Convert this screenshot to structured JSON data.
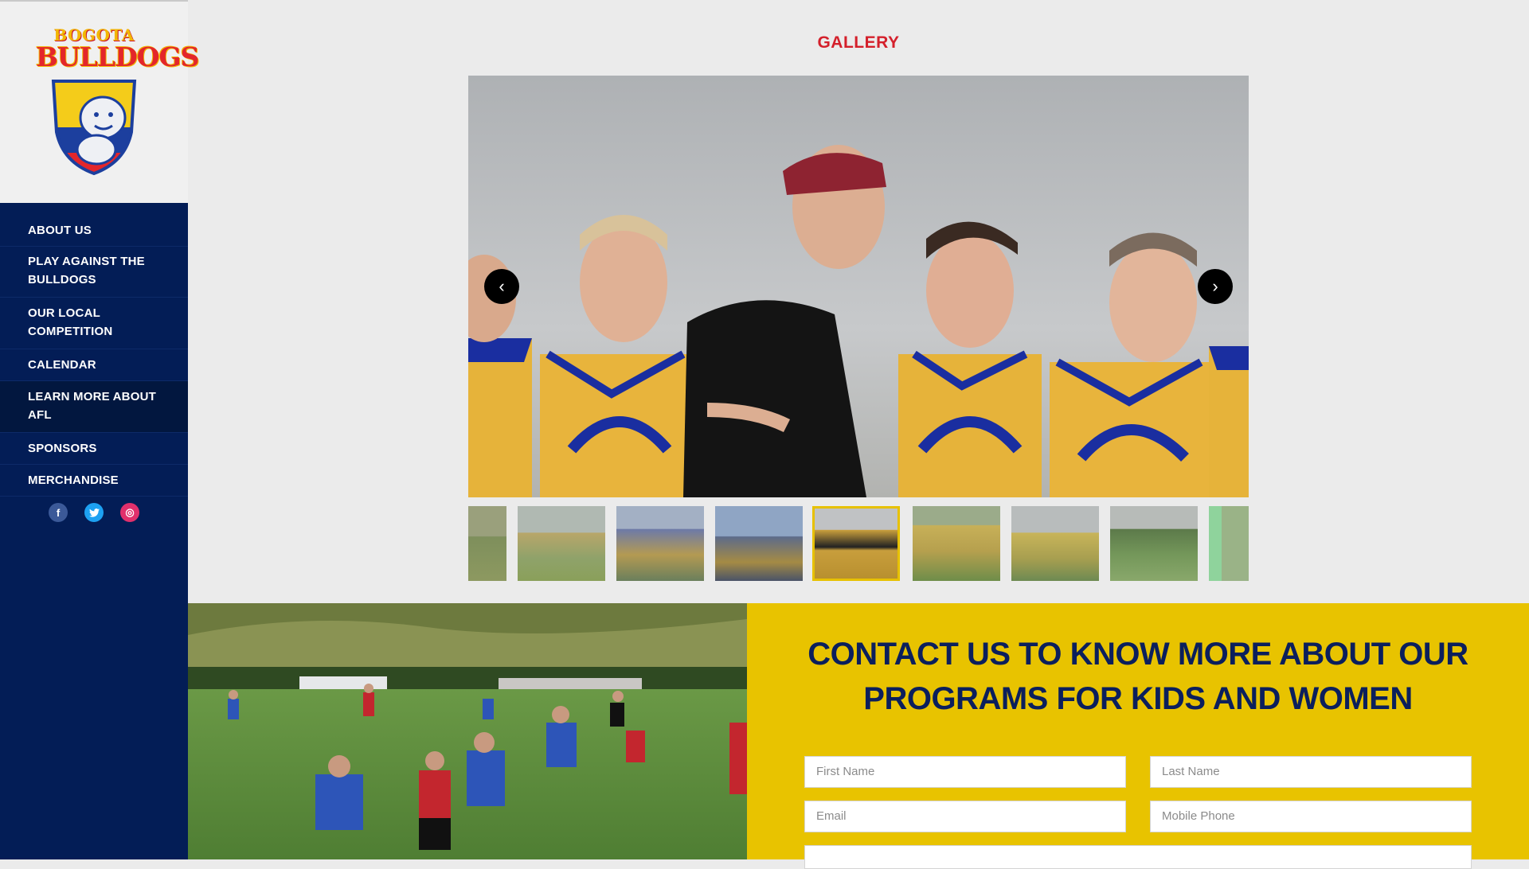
{
  "brand": {
    "logo_top": "BOGOTA",
    "logo_main": "BULLDOGS"
  },
  "nav": {
    "items": [
      {
        "label": "ABOUT US"
      },
      {
        "label": "PLAY AGAINST THE BULLDOGS"
      },
      {
        "label": "OUR LOCAL COMPETITION"
      },
      {
        "label": "CALENDAR"
      },
      {
        "label": "LEARN MORE ABOUT AFL"
      },
      {
        "label": "SPONSORS"
      },
      {
        "label": "MERCHANDISE"
      }
    ],
    "active_index": 4
  },
  "social": {
    "facebook_glyph": "f",
    "twitter_glyph": "t",
    "instagram_glyph": "◎"
  },
  "gallery": {
    "title": "GALLERY",
    "prev_glyph": "‹",
    "next_glyph": "›",
    "thumbnail_count": 9,
    "active_thumbnail": 5
  },
  "contact": {
    "title_line1": "CONTACT US TO KNOW MORE ABOUT OUR",
    "title_line2": "PROGRAMS FOR KIDS AND WOMEN",
    "fields": {
      "first_name": "First Name",
      "last_name": "Last Name",
      "email": "Email",
      "mobile_phone": "Mobile Phone"
    }
  },
  "colors": {
    "sidebar_bg": "#031d56",
    "accent_red": "#d4202b",
    "contact_bg": "#e8c300",
    "contact_text": "#0b1f5c",
    "thumb_active_border": "#e7c100"
  }
}
